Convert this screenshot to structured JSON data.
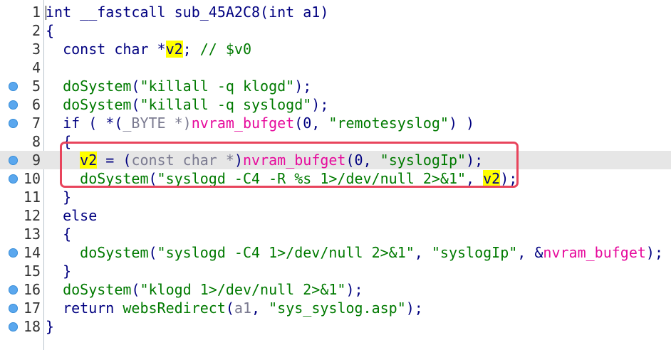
{
  "lines": [
    {
      "n": "1",
      "bp": false,
      "hl": false,
      "parts": [
        {
          "t": "int __fastcall sub_45A2C8(int a1)",
          "c": "kw"
        }
      ]
    },
    {
      "n": "2",
      "bp": false,
      "hl": false,
      "parts": [
        {
          "t": "{",
          "c": "kw"
        }
      ]
    },
    {
      "n": "3",
      "bp": false,
      "hl": false,
      "parts": [
        {
          "t": "  const char *",
          "c": "kw"
        },
        {
          "t": "v2",
          "c": "var"
        },
        {
          "t": "; ",
          "c": "kw"
        },
        {
          "t": "// $v0",
          "c": "cmt"
        }
      ]
    },
    {
      "n": "4",
      "bp": false,
      "hl": false,
      "parts": []
    },
    {
      "n": "5",
      "bp": true,
      "hl": false,
      "parts": [
        {
          "t": "  ",
          "c": "kw"
        },
        {
          "t": "doSystem",
          "c": "str"
        },
        {
          "t": "(",
          "c": "kw"
        },
        {
          "t": "\"killall -q klogd\"",
          "c": "str"
        },
        {
          "t": ");",
          "c": "kw"
        }
      ]
    },
    {
      "n": "6",
      "bp": true,
      "hl": false,
      "parts": [
        {
          "t": "  ",
          "c": "kw"
        },
        {
          "t": "doSystem",
          "c": "str"
        },
        {
          "t": "(",
          "c": "kw"
        },
        {
          "t": "\"killall -q syslogd\"",
          "c": "str"
        },
        {
          "t": ");",
          "c": "kw"
        }
      ]
    },
    {
      "n": "7",
      "bp": true,
      "hl": false,
      "parts": [
        {
          "t": "  if ( *(",
          "c": "kw"
        },
        {
          "t": "_BYTE",
          "c": "typ"
        },
        {
          "t": " *)",
          "c": "typ"
        },
        {
          "t": "nvram_bufget",
          "c": "imp"
        },
        {
          "t": "(0, ",
          "c": "kw"
        },
        {
          "t": "\"remotesyslog\"",
          "c": "str"
        },
        {
          "t": ") )",
          "c": "kw"
        }
      ]
    },
    {
      "n": "8",
      "bp": false,
      "hl": false,
      "parts": [
        {
          "t": "  {",
          "c": "kw"
        }
      ]
    },
    {
      "n": "9",
      "bp": true,
      "hl": true,
      "parts": [
        {
          "t": "    ",
          "c": "kw"
        },
        {
          "t": "v2",
          "c": "var"
        },
        {
          "t": " = (",
          "c": "kw"
        },
        {
          "t": "const char *",
          "c": "typ"
        },
        {
          "t": ")",
          "c": "kw"
        },
        {
          "t": "nvram_bufget",
          "c": "imp"
        },
        {
          "t": "(0, ",
          "c": "kw"
        },
        {
          "t": "\"syslogIp\"",
          "c": "str"
        },
        {
          "t": ");",
          "c": "kw"
        }
      ]
    },
    {
      "n": "10",
      "bp": true,
      "hl": false,
      "parts": [
        {
          "t": "    ",
          "c": "kw"
        },
        {
          "t": "doSystem",
          "c": "str"
        },
        {
          "t": "(",
          "c": "kw"
        },
        {
          "t": "\"syslogd -C4 -R %s 1>/dev/null 2>&1\"",
          "c": "str"
        },
        {
          "t": ", ",
          "c": "kw"
        },
        {
          "t": "v2",
          "c": "var"
        },
        {
          "t": ");",
          "c": "kw"
        }
      ]
    },
    {
      "n": "11",
      "bp": false,
      "hl": false,
      "parts": [
        {
          "t": "  }",
          "c": "kw"
        }
      ]
    },
    {
      "n": "12",
      "bp": false,
      "hl": false,
      "parts": [
        {
          "t": "  else",
          "c": "kw"
        }
      ]
    },
    {
      "n": "13",
      "bp": false,
      "hl": false,
      "parts": [
        {
          "t": "  {",
          "c": "kw"
        }
      ]
    },
    {
      "n": "14",
      "bp": true,
      "hl": false,
      "parts": [
        {
          "t": "    ",
          "c": "kw"
        },
        {
          "t": "doSystem",
          "c": "str"
        },
        {
          "t": "(",
          "c": "kw"
        },
        {
          "t": "\"syslogd -C4 1>/dev/null 2>&1\"",
          "c": "str"
        },
        {
          "t": ", ",
          "c": "kw"
        },
        {
          "t": "\"syslogIp\"",
          "c": "str"
        },
        {
          "t": ", &",
          "c": "kw"
        },
        {
          "t": "nvram_bufget",
          "c": "imp"
        },
        {
          "t": ");",
          "c": "kw"
        }
      ]
    },
    {
      "n": "15",
      "bp": false,
      "hl": false,
      "parts": [
        {
          "t": "  }",
          "c": "kw"
        }
      ]
    },
    {
      "n": "16",
      "bp": true,
      "hl": false,
      "parts": [
        {
          "t": "  ",
          "c": "kw"
        },
        {
          "t": "doSystem",
          "c": "str"
        },
        {
          "t": "(",
          "c": "kw"
        },
        {
          "t": "\"klogd 1>/dev/null 2>&1\"",
          "c": "str"
        },
        {
          "t": ");",
          "c": "kw"
        }
      ]
    },
    {
      "n": "17",
      "bp": true,
      "hl": false,
      "parts": [
        {
          "t": "  return ",
          "c": "kw"
        },
        {
          "t": "websRedirect",
          "c": "str"
        },
        {
          "t": "(",
          "c": "kw"
        },
        {
          "t": "a1",
          "c": "arg"
        },
        {
          "t": ", ",
          "c": "kw"
        },
        {
          "t": "\"sys_syslog.asp\"",
          "c": "str"
        },
        {
          "t": ");",
          "c": "kw"
        }
      ]
    },
    {
      "n": "18",
      "bp": true,
      "hl": false,
      "parts": [
        {
          "t": "}",
          "c": "kw"
        }
      ]
    }
  ],
  "colors": {
    "highlight_box": "#e8445c",
    "var_highlight": "#ffff00",
    "current_line": "#e6e6e6",
    "breakpoint": "#5aa7ee"
  }
}
